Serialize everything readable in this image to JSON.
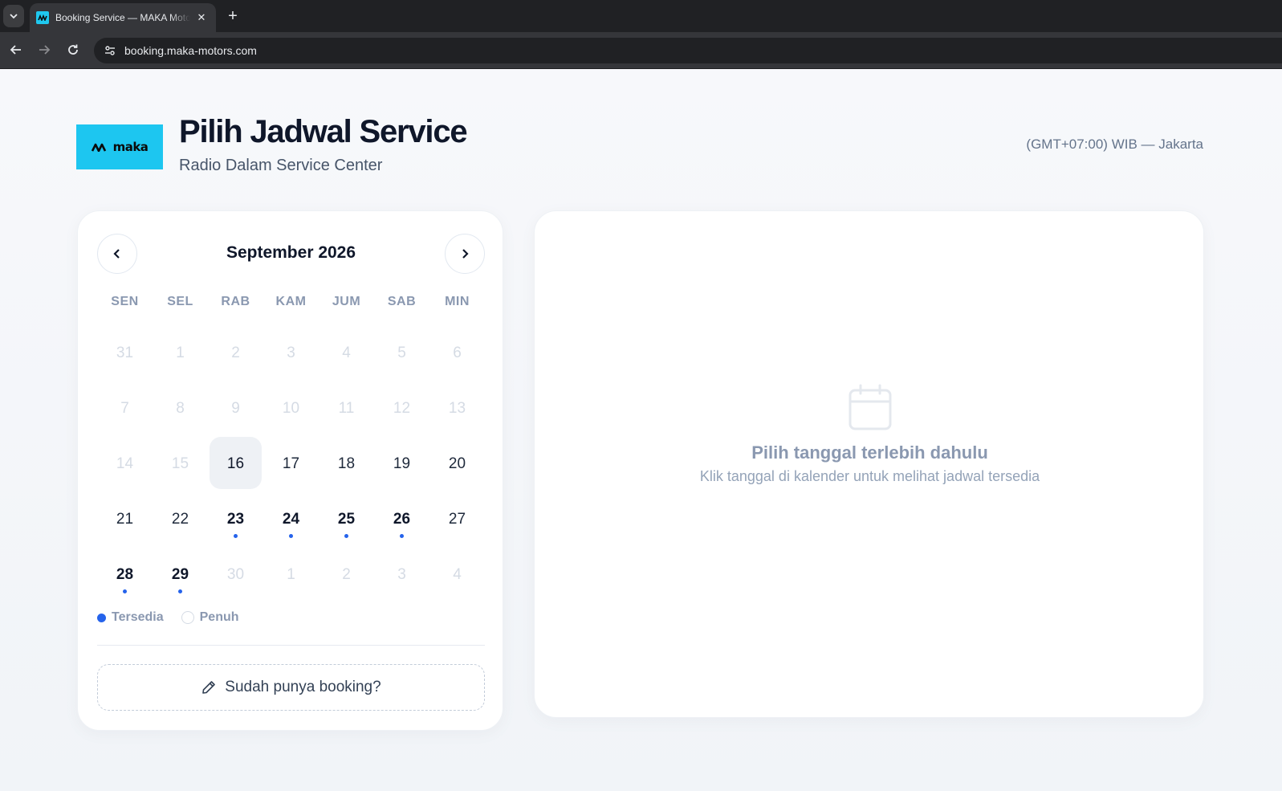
{
  "browser": {
    "tab_title": "Booking Service — MAKA Motors",
    "url": "booking.maka-motors.com",
    "new_tab_label": "+",
    "close_label": "✕"
  },
  "header": {
    "logo_text": "maka",
    "title": "Pilih Jadwal Service",
    "subtitle": "Radio Dalam Service Center",
    "timezone": "(GMT+07:00) WIB — Jakarta"
  },
  "calendar": {
    "month_label": "September 2026",
    "weekdays": [
      "SEN",
      "SEL",
      "RAB",
      "KAM",
      "JUM",
      "SAB",
      "MIN"
    ],
    "days": [
      {
        "label": "31",
        "state": "muted"
      },
      {
        "label": "1",
        "state": "past"
      },
      {
        "label": "2",
        "state": "past"
      },
      {
        "label": "3",
        "state": "past"
      },
      {
        "label": "4",
        "state": "past"
      },
      {
        "label": "5",
        "state": "past"
      },
      {
        "label": "6",
        "state": "past"
      },
      {
        "label": "7",
        "state": "past"
      },
      {
        "label": "8",
        "state": "past"
      },
      {
        "label": "9",
        "state": "past"
      },
      {
        "label": "10",
        "state": "past"
      },
      {
        "label": "11",
        "state": "past"
      },
      {
        "label": "12",
        "state": "past"
      },
      {
        "label": "13",
        "state": "past"
      },
      {
        "label": "14",
        "state": "past"
      },
      {
        "label": "15",
        "state": "past"
      },
      {
        "label": "16",
        "state": "today"
      },
      {
        "label": "17",
        "state": "normal"
      },
      {
        "label": "18",
        "state": "normal"
      },
      {
        "label": "19",
        "state": "normal"
      },
      {
        "label": "20",
        "state": "normal"
      },
      {
        "label": "21",
        "state": "normal"
      },
      {
        "label": "22",
        "state": "normal"
      },
      {
        "label": "23",
        "state": "available"
      },
      {
        "label": "24",
        "state": "available"
      },
      {
        "label": "25",
        "state": "available"
      },
      {
        "label": "26",
        "state": "available"
      },
      {
        "label": "27",
        "state": "normal"
      },
      {
        "label": "28",
        "state": "available"
      },
      {
        "label": "29",
        "state": "available"
      },
      {
        "label": "30",
        "state": "muted"
      },
      {
        "label": "1",
        "state": "muted"
      },
      {
        "label": "2",
        "state": "muted"
      },
      {
        "label": "3",
        "state": "muted"
      },
      {
        "label": "4",
        "state": "muted"
      }
    ],
    "legend": {
      "available_label": "Tersedia",
      "full_label": "Penuh"
    },
    "booking_button_label": "Sudah punya booking?"
  },
  "slots": {
    "empty_title": "Pilih tanggal terlebih dahulu",
    "empty_subtitle": "Klik tanggal di kalender untuk melihat jadwal tersedia"
  },
  "colors": {
    "brand": "#1dc6f0",
    "accent": "#2563eb",
    "text_dark": "#0f172a",
    "muted": "#8a98b0"
  }
}
